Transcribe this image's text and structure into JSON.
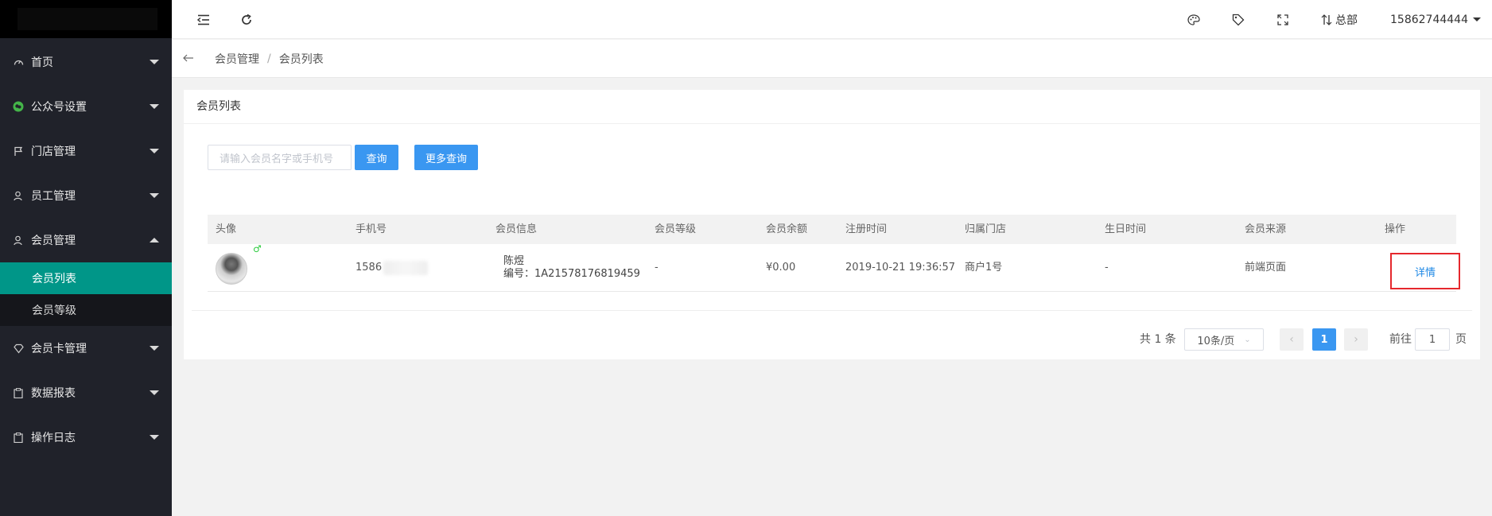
{
  "sidebar": {
    "menu": [
      {
        "label": "首页",
        "icon": "dashboard-icon"
      },
      {
        "label": "公众号设置",
        "icon": "wechat-icon"
      },
      {
        "label": "门店管理",
        "icon": "flag-icon"
      },
      {
        "label": "员工管理",
        "icon": "user-icon"
      },
      {
        "label": "会员管理",
        "icon": "user-icon"
      },
      {
        "label": "会员卡管理",
        "icon": "diamond-icon"
      },
      {
        "label": "数据报表",
        "icon": "clipboard-icon"
      },
      {
        "label": "操作日志",
        "icon": "clipboard-icon"
      }
    ],
    "submenu": [
      {
        "label": "会员列表",
        "active": true
      },
      {
        "label": "会员等级",
        "active": false
      }
    ]
  },
  "header": {
    "branch": "总部",
    "user": "15862744444"
  },
  "breadcrumb": [
    "会员管理",
    "会员列表"
  ],
  "card": {
    "title": "会员列表",
    "search_placeholder": "请输入会员名字或手机号",
    "query_label": "查询",
    "more_query_label": "更多查询"
  },
  "table": {
    "columns": [
      "头像",
      "手机号",
      "会员信息",
      "会员等级",
      "会员余额",
      "注册时间",
      "归属门店",
      "生日时间",
      "会员来源",
      "操作"
    ],
    "rows": [
      {
        "gender": "♂",
        "phone": "1586",
        "name": "陈煜",
        "number": "编号：1A21578176819459",
        "level": "-",
        "balance": "¥0.00",
        "register_time": "2019-10-21 19:36:57",
        "store": "商户1号",
        "birthday": "-",
        "source": "前端页面",
        "action": "详情"
      }
    ]
  },
  "pagination": {
    "total": "共 1 条",
    "page_size": "10条/页",
    "current_page": "1",
    "goto_label": "前往",
    "goto_value": "1",
    "page_suffix": "页"
  },
  "colors": {
    "sidebar_bg": "#20222a",
    "active_teal": "#009688",
    "primary_blue": "#3a97f1",
    "highlight_red": "#e5282d"
  }
}
